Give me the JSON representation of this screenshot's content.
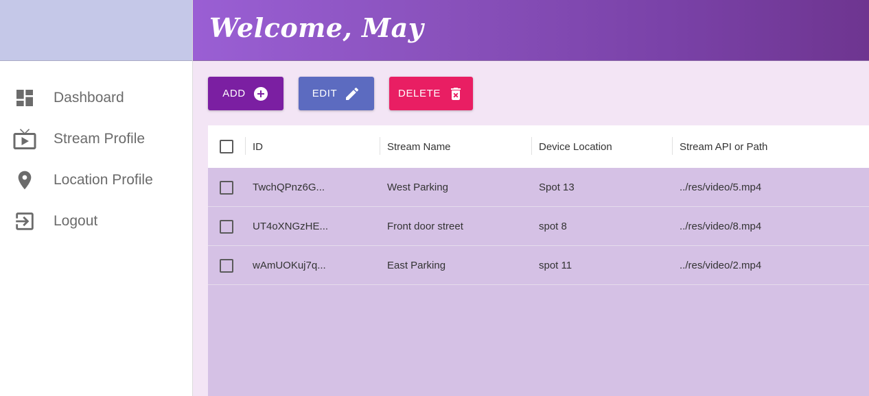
{
  "header": {
    "welcome": "Welcome, May"
  },
  "sidebar": {
    "items": [
      {
        "label": "Dashboard",
        "icon": "dashboard-icon"
      },
      {
        "label": "Stream Profile",
        "icon": "tv-icon"
      },
      {
        "label": "Location Profile",
        "icon": "location-pin-icon"
      },
      {
        "label": "Logout",
        "icon": "logout-icon"
      }
    ]
  },
  "toolbar": {
    "add_label": "ADD",
    "edit_label": "EDIT",
    "delete_label": "DELETE"
  },
  "table": {
    "columns": [
      "ID",
      "Stream Name",
      "Device Location",
      "Stream API or Path"
    ],
    "rows": [
      {
        "id": "TwchQPnz6G...",
        "name": "West Parking",
        "location": "Spot 13",
        "path": "../res/video/5.mp4"
      },
      {
        "id": "UT4oXNGzHE...",
        "name": "Front door street",
        "location": "spot 8",
        "path": "../res/video/8.mp4"
      },
      {
        "id": "wAmUOKuj7q...",
        "name": "East Parking",
        "location": "spot 11",
        "path": "../res/video/2.mp4"
      }
    ]
  },
  "colors": {
    "add": "#7b1fa2",
    "edit": "#5c6bc0",
    "delete": "#e91e63",
    "sidebar_top": "#c5c8e8",
    "main_bg": "#f3e5f5",
    "rows_bg": "#d5c1e5"
  }
}
